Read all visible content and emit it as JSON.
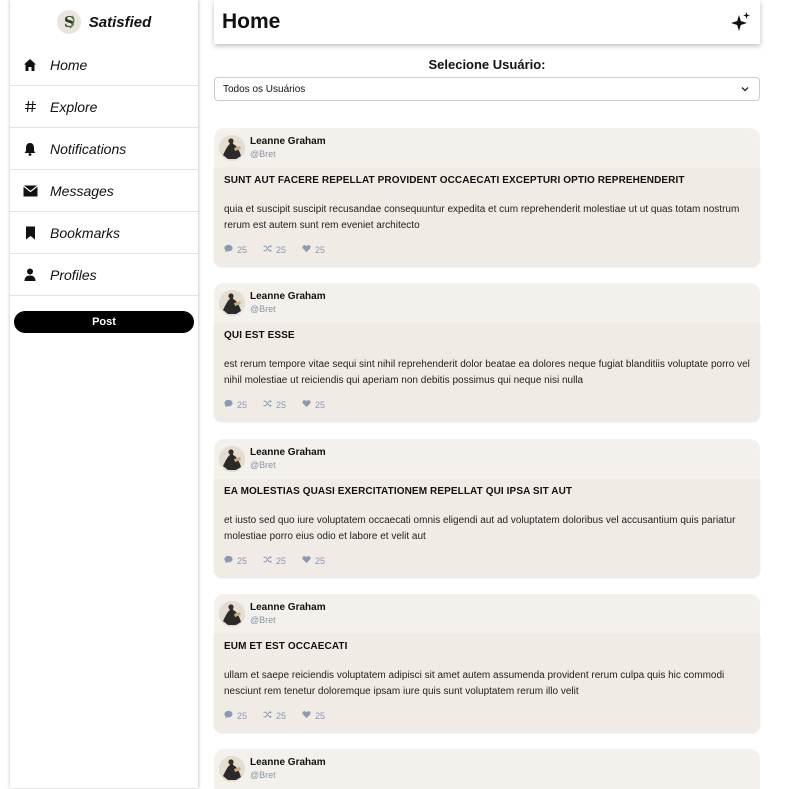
{
  "brand": {
    "name": "Satisfied",
    "logo_icon": "s-logo-icon"
  },
  "sidebar": {
    "items": [
      {
        "label": "Home",
        "icon": "home-icon"
      },
      {
        "label": "Explore",
        "icon": "hash-icon"
      },
      {
        "label": "Notifications",
        "icon": "bell-icon"
      },
      {
        "label": "Messages",
        "icon": "envelope-icon"
      },
      {
        "label": "Bookmarks",
        "icon": "bookmark-icon"
      },
      {
        "label": "Profiles",
        "icon": "user-icon"
      }
    ],
    "post_button": "Post"
  },
  "header": {
    "title": "Home",
    "action_icon": "sparkles-icon"
  },
  "filter": {
    "label": "Selecione Usuário:",
    "selected": "Todos os Usuários"
  },
  "posts": [
    {
      "author": "Leanne Graham",
      "handle": "@Bret",
      "title": "SUNT AUT FACERE REPELLAT PROVIDENT OCCAECATI EXCEPTURI OPTIO REPREHENDERIT",
      "body": "quia et suscipit suscipit recusandae consequuntur expedita et cum reprehenderit molestiae ut ut quas totam nostrum rerum est autem sunt rem eveniet architecto",
      "comments": "25",
      "reposts": "25",
      "likes": "25"
    },
    {
      "author": "Leanne Graham",
      "handle": "@Bret",
      "title": "QUI EST ESSE",
      "body": "est rerum tempore vitae sequi sint nihil reprehenderit dolor beatae ea dolores neque fugiat blanditiis voluptate porro vel nihil molestiae ut reiciendis qui aperiam non debitis possimus qui neque nisi nulla",
      "comments": "25",
      "reposts": "25",
      "likes": "25"
    },
    {
      "author": "Leanne Graham",
      "handle": "@Bret",
      "title": "EA MOLESTIAS QUASI EXERCITATIONEM REPELLAT QUI IPSA SIT AUT",
      "body": "et iusto sed quo iure voluptatem occaecati omnis eligendi aut ad voluptatem doloribus vel accusantium quis pariatur molestiae porro eius odio et labore et velit aut",
      "comments": "25",
      "reposts": "25",
      "likes": "25"
    },
    {
      "author": "Leanne Graham",
      "handle": "@Bret",
      "title": "EUM ET EST OCCAECATI",
      "body": "ullam et saepe reiciendis voluptatem adipisci sit amet autem assumenda provident rerum culpa quis hic commodi nesciunt rem tenetur doloremque ipsam iure quis sunt voluptatem rerum illo velit",
      "comments": "25",
      "reposts": "25",
      "likes": "25"
    },
    {
      "author": "Leanne Graham",
      "handle": "@Bret"
    }
  ]
}
